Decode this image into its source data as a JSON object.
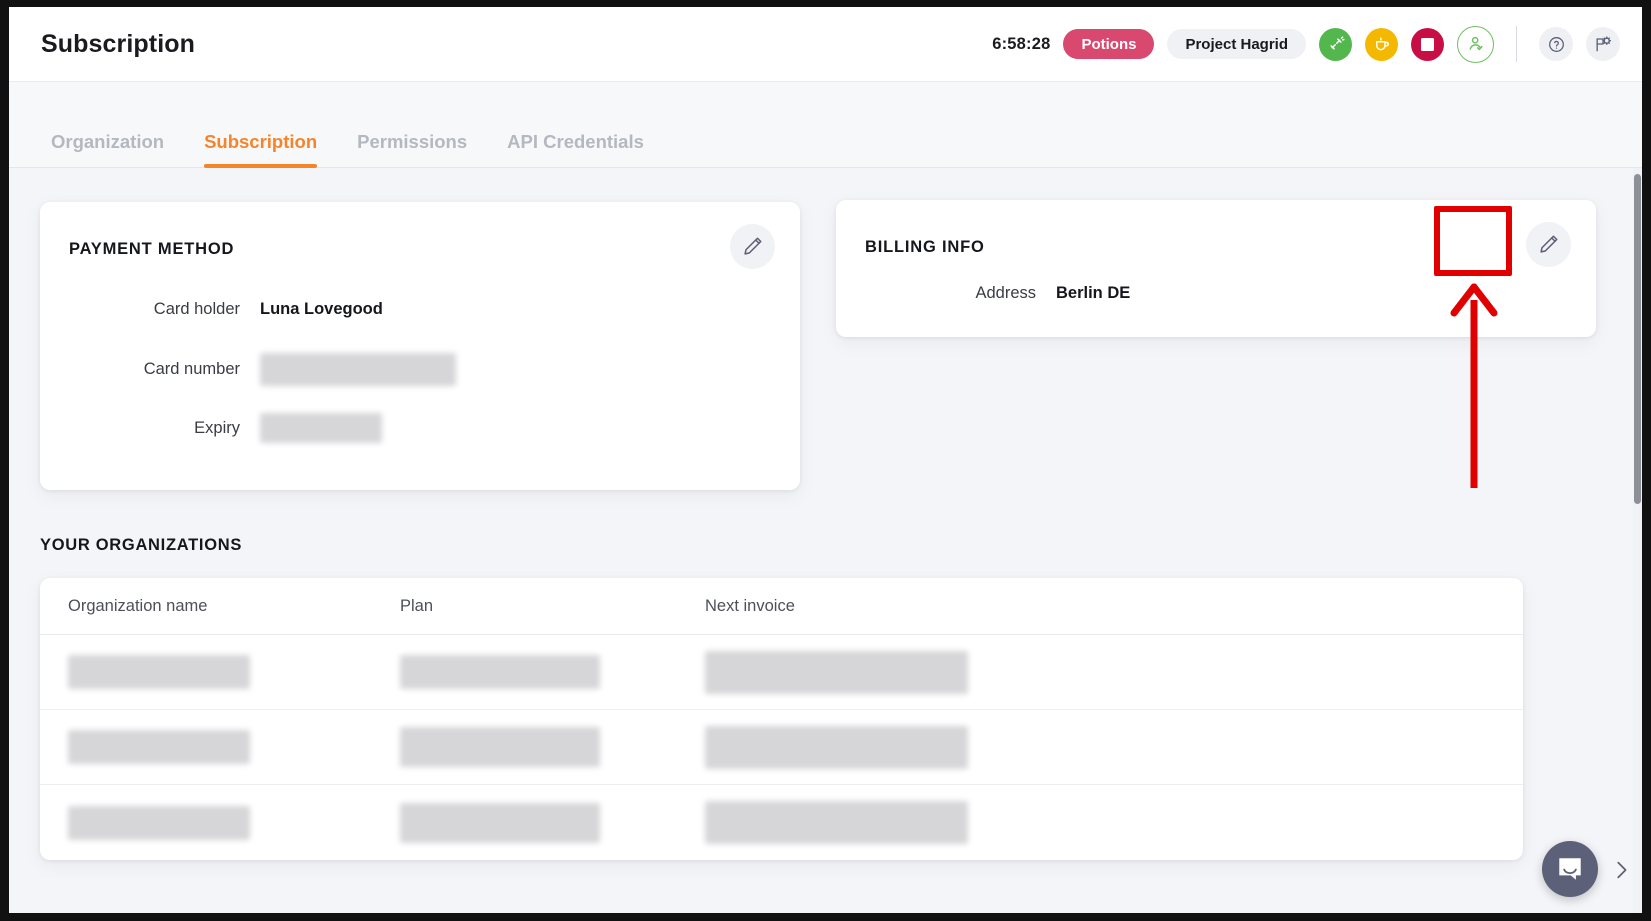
{
  "header": {
    "title": "Subscription",
    "clock": "6:58:28",
    "badge_potions": "Potions",
    "badge_project": "Project Hagrid",
    "colors": {
      "potions_pink": "#d9486f",
      "green": "#53b74d",
      "yellow": "#f5b800",
      "red": "#c80f45",
      "outline_green": "#6fbf63",
      "accent_orange": "#f5842a"
    },
    "icons": [
      "connection-icon",
      "coffee-cup-icon",
      "stop-square-icon",
      "user-check-icon",
      "help-circle-icon",
      "flag-settings-icon"
    ]
  },
  "tabs": [
    {
      "label": "Organization",
      "active": false
    },
    {
      "label": "Subscription",
      "active": true
    },
    {
      "label": "Permissions",
      "active": false
    },
    {
      "label": "API Credentials",
      "active": false
    }
  ],
  "payment_method": {
    "title": "PAYMENT METHOD",
    "fields": [
      {
        "label": "Card holder",
        "value": "Luna Lovegood",
        "redacted": false
      },
      {
        "label": "Card number",
        "value": "",
        "redacted": true
      },
      {
        "label": "Expiry",
        "value": "",
        "redacted": true
      }
    ]
  },
  "billing_info": {
    "title": "BILLING INFO",
    "fields": [
      {
        "label": "Address",
        "value": "Berlin DE",
        "redacted": false
      }
    ]
  },
  "organizations": {
    "section_title": "YOUR ORGANIZATIONS",
    "columns": [
      "Organization name",
      "Plan",
      "Next invoice"
    ],
    "rows": [
      {
        "name": "",
        "plan": "",
        "next_invoice": "",
        "redacted": true
      },
      {
        "name": "",
        "plan": "",
        "next_invoice": "",
        "redacted": true
      },
      {
        "name": "",
        "plan": "",
        "next_invoice": "",
        "redacted": true
      }
    ]
  },
  "annotation": {
    "color": "#e00000",
    "target": "billing-info-edit-button",
    "shape": "rectangle-with-up-arrow"
  },
  "chat": {
    "widget": "intercom-chat-bubble",
    "color": "#5c6179"
  }
}
